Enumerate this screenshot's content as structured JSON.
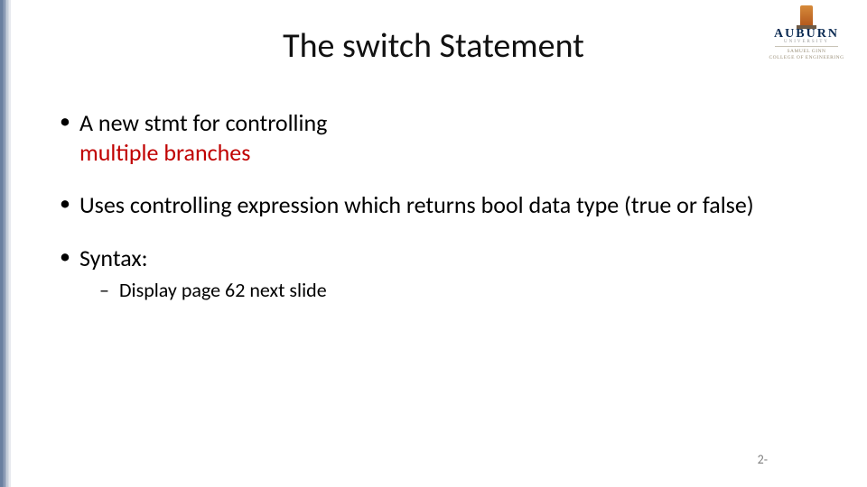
{
  "title": "The switch Statement",
  "logo": {
    "main": "AUBURN",
    "sub1": "UNIVERSITY",
    "sub2a": "SAMUEL GINN",
    "sub2b": "COLLEGE OF ENGINEERING"
  },
  "bullets": {
    "b1_pre": "A new stmt for controlling ",
    "b1_red": "multiple branches",
    "b2": "Uses controlling expression which returns bool data type (true or false)",
    "b3": "Syntax:",
    "b3_sub1": "Display page 62 next slide"
  },
  "page_number": "2-"
}
